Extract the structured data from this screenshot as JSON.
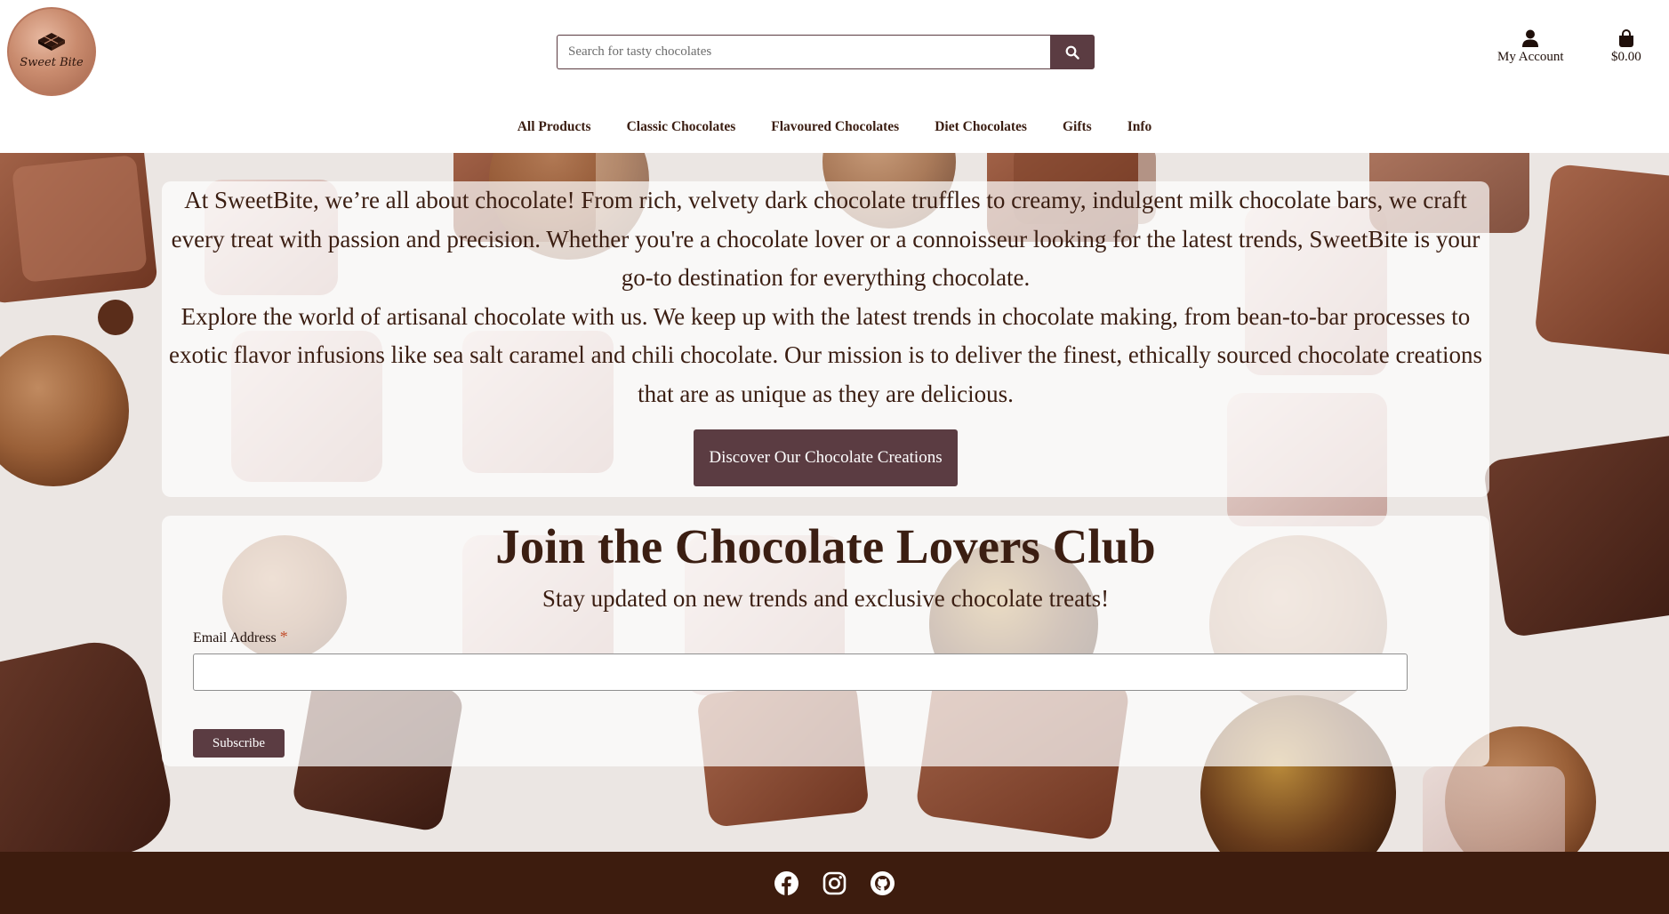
{
  "brand": {
    "logo_text": "Sweet Bite"
  },
  "search": {
    "placeholder": "Search for tasty chocolates"
  },
  "header": {
    "account_label": "My Account",
    "cart_total": "$0.00"
  },
  "nav": {
    "items": [
      "All Products",
      "Classic Chocolates",
      "Flavoured Chocolates",
      "Diet Chocolates",
      "Gifts",
      "Info"
    ]
  },
  "intro": {
    "paragraph1": "At SweetBite, we’re all about chocolate! From rich, velvety dark chocolate truffles to creamy, indulgent milk chocolate bars, we craft every treat with passion and precision. Whether you're a chocolate lover or a connoisseur looking for the latest trends, SweetBite is your go-to destination for everything chocolate.",
    "paragraph2": "Explore the world of artisanal chocolate with us. We keep up with the latest trends in chocolate making, from bean-to-bar processes to exotic flavor infusions like sea salt caramel and chili chocolate. Our mission is to deliver the finest, ethically sourced chocolate creations that are as unique as they are delicious.",
    "cta_label": "Discover Our Chocolate Creations"
  },
  "club": {
    "title": "Join the Chocolate Lovers Club",
    "subtitle": "Stay updated on new trends and exclusive chocolate treats!",
    "email_label": "Email Address",
    "required_mark": "*",
    "subscribe_label": "Subscribe"
  },
  "footer": {
    "social_icons": [
      "facebook-icon",
      "instagram-icon",
      "github-icon"
    ]
  },
  "colors": {
    "primary_button": "#5b3c42",
    "text_brown": "#3b1e12",
    "footer_bg": "#3d1c0e"
  }
}
